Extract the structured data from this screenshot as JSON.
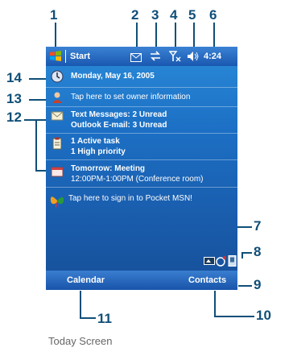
{
  "callouts": [
    "1",
    "2",
    "3",
    "4",
    "5",
    "6",
    "7",
    "8",
    "9",
    "10",
    "11",
    "12",
    "13",
    "14"
  ],
  "titlebar": {
    "start_label": "Start",
    "time": "4:24"
  },
  "today": {
    "date": "Monday, May 16, 2005",
    "owner": "Tap here to set owner information",
    "messages_line1": "Text Messages: 2 Unread",
    "messages_line2": "Outlook E-mail: 3 Unread",
    "tasks_line1": "1 Active task",
    "tasks_line2": "1 High priority",
    "calendar_line1": "Tomorrow: Meeting",
    "calendar_line2": "12:00PM-1:00PM (Conference room)",
    "msn": "Tap here to sign in to Pocket MSN!"
  },
  "softkeys": {
    "left": "Calendar",
    "right": "Contacts"
  },
  "caption": "Today Screen",
  "colors": {
    "callout": "#0f4f78",
    "background": "#1c6fc4"
  }
}
